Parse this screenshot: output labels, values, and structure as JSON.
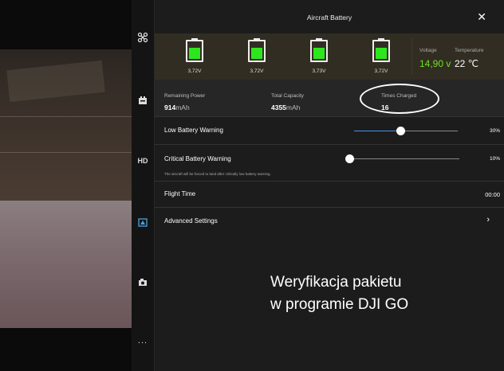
{
  "window": {
    "title": "Aircraft Battery",
    "close_icon": "close-icon"
  },
  "cells": [
    {
      "voltage": "3,72V",
      "level": 0.68
    },
    {
      "voltage": "3,72V",
      "level": 0.68
    },
    {
      "voltage": "3,73V",
      "level": 0.68
    },
    {
      "voltage": "3,72V",
      "level": 0.68
    }
  ],
  "battery_meta": {
    "voltage_label": "Voltage",
    "voltage_value": "14,90 v",
    "temperature_label": "Temperature",
    "temperature_value": "22 ℃"
  },
  "stats": {
    "remaining_power_label": "Remaining Power",
    "remaining_power_value": "914",
    "remaining_power_unit": "mAh",
    "total_capacity_label": "Total Capacity",
    "total_capacity_value": "4355",
    "total_capacity_unit": "mAh",
    "times_charged_label": "Times Charged",
    "times_charged_value": "16"
  },
  "settings": {
    "low_battery_label": "Low Battery Warning",
    "low_battery_value": "30%",
    "low_battery_level": 0.3,
    "critical_battery_label": "Critical Battery Warning",
    "critical_battery_value": "10%",
    "critical_battery_level": 0.1,
    "critical_note": "The aircraft will be forced to land after critically low battery warning.",
    "flight_time_label": "Flight Time",
    "flight_time_value": "00:00",
    "advanced_settings_label": "Advanced Settings"
  },
  "toolbar": {
    "items": [
      {
        "icon": "aircraft-status-icon"
      },
      {
        "icon": "battery-icon"
      },
      {
        "label": "HD"
      },
      {
        "icon": "image-transmission-icon"
      },
      {
        "icon": "camera-icon"
      },
      {
        "label": "..."
      }
    ]
  },
  "caption": {
    "line1": "Weryfikacja pakietu",
    "line2": "w programie DJI GO"
  },
  "colors": {
    "accent": "#4a90e2",
    "battery_fill": "#2ee61e",
    "voltage_green": "#6fe21f"
  }
}
